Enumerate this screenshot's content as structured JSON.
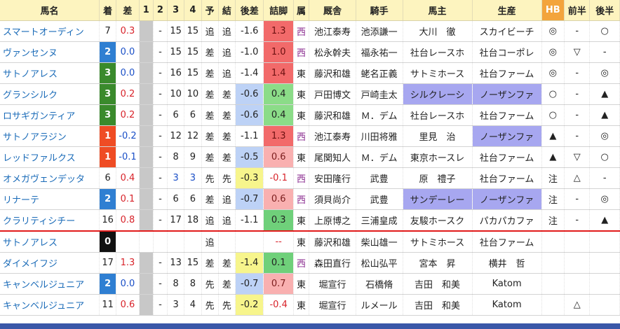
{
  "headers": [
    "馬名",
    "着",
    "差",
    "1",
    "2",
    "3",
    "4",
    "予",
    "結",
    "後差",
    "詰脚",
    "属",
    "厩舎",
    "騎手",
    "馬主",
    "生産",
    "HB",
    "前半",
    "後半"
  ],
  "rows": [
    [
      "スマートオーディン",
      "7",
      "0.3",
      "",
      "-",
      "15",
      "15",
      "追",
      "追",
      "-1.6",
      "1.3",
      "西",
      "池江泰寿",
      "池添謙一",
      "大川　徹",
      "スカイビーチ",
      "◎",
      "-",
      "○"
    ],
    [
      "ヴァンセンヌ",
      "2",
      "0.0",
      "",
      "-",
      "15",
      "15",
      "差",
      "追",
      "-1.0",
      "1.0",
      "西",
      "松永幹夫",
      "福永祐一",
      "社台レースホ",
      "社台コーポレ",
      "◎",
      "▽",
      "-"
    ],
    [
      "サトノアレス",
      "3",
      "0.0",
      "",
      "-",
      "16",
      "15",
      "差",
      "追",
      "-1.4",
      "1.4",
      "東",
      "藤沢和雄",
      "蛯名正義",
      "サトミホース",
      "社台ファーム",
      "◎",
      "-",
      "◎"
    ],
    [
      "グランシルク",
      "3",
      "0.2",
      "",
      "-",
      "10",
      "10",
      "差",
      "差",
      "-0.6",
      "0.4",
      "東",
      "戸田博文",
      "戸崎圭太",
      "シルクレーシ",
      "ノーザンファ",
      "○",
      "-",
      "▲"
    ],
    [
      "ロサギガンティア",
      "3",
      "0.2",
      "",
      "-",
      "6",
      "6",
      "差",
      "差",
      "-0.6",
      "0.4",
      "東",
      "藤沢和雄",
      "Ｍ．デム",
      "社台レースホ",
      "社台ファーム",
      "○",
      "-",
      "▲"
    ],
    [
      "サトノアラジン",
      "1",
      "-0.2",
      "",
      "-",
      "12",
      "12",
      "差",
      "差",
      "-1.1",
      "1.3",
      "西",
      "池江泰寿",
      "川田将雅",
      "里見　治",
      "ノーザンファ",
      "▲",
      "-",
      "◎"
    ],
    [
      "レッドファルクス",
      "1",
      "-0.1",
      "",
      "-",
      "8",
      "9",
      "差",
      "差",
      "-0.5",
      "0.6",
      "東",
      "尾関知人",
      "Ｍ．デム",
      "東京ホースレ",
      "社台ファーム",
      "▲",
      "▽",
      "○"
    ],
    [
      "オメガヴェンデッタ",
      "6",
      "0.4",
      "",
      "-",
      "3",
      "3",
      "先",
      "先",
      "-0.3",
      "-0.1",
      "西",
      "安田隆行",
      "武豊",
      "原　禮子",
      "社台ファーム",
      "注",
      "△",
      "-"
    ],
    [
      "リナーテ",
      "2",
      "0.1",
      "",
      "-",
      "6",
      "6",
      "差",
      "追",
      "-0.7",
      "0.6",
      "西",
      "須貝尚介",
      "武豊",
      "サンデーレー",
      "ノーザンファ",
      "注",
      "-",
      "◎"
    ],
    [
      "クラリティシチー",
      "16",
      "0.8",
      "",
      "-",
      "17",
      "18",
      "追",
      "追",
      "-1.1",
      "0.3",
      "東",
      "上原博之",
      "三浦皇成",
      "友駿ホースク",
      "パカパカファ",
      "注",
      "-",
      "▲"
    ],
    [
      "サトノアレス",
      "0",
      "",
      "",
      "",
      "",
      "",
      "追",
      "",
      "",
      "--",
      "東",
      "藤沢和雄",
      "柴山雄一",
      "サトミホース",
      "社台ファーム",
      "",
      "",
      ""
    ],
    [
      "ダイメイフジ",
      "17",
      "1.3",
      "",
      "-",
      "13",
      "15",
      "差",
      "差",
      "-1.4",
      "0.1",
      "西",
      "森田直行",
      "松山弘平",
      "宮本　昇",
      "横井　哲",
      "",
      "",
      ""
    ],
    [
      "キャンベルジュニア",
      "2",
      "0.0",
      "",
      "-",
      "8",
      "8",
      "先",
      "差",
      "-0.7",
      "0.7",
      "東",
      "堀宣行",
      "石橋脩",
      "吉田　和美",
      "Katom",
      "",
      "",
      ""
    ],
    [
      "キャンベルジュニア",
      "11",
      "0.6",
      "",
      "-",
      "3",
      "4",
      "先",
      "先",
      "-0.2",
      "-0.4",
      "東",
      "堀宣行",
      "ルメール",
      "吉田　和美",
      "Katom",
      "",
      "△",
      ""
    ]
  ]
}
